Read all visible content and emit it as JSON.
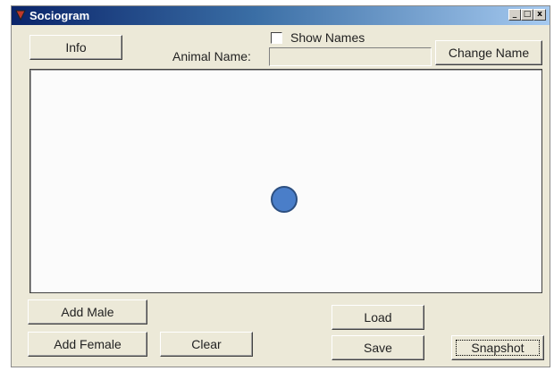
{
  "window": {
    "title": "Sociogram",
    "controls": {
      "minimize": "_",
      "maximize": "□",
      "close": "x"
    }
  },
  "toolbar": {
    "info_label": "Info",
    "show_names_label": "Show Names",
    "show_names_checked": false,
    "animal_name_label": "Animal Name:",
    "animal_name_value": "",
    "change_name_label": "Change Name"
  },
  "canvas": {
    "nodes": [
      {
        "type": "animal",
        "color": "#4a7ec9"
      }
    ]
  },
  "bottom": {
    "add_male_label": "Add Male",
    "add_female_label": "Add Female",
    "clear_label": "Clear",
    "load_label": "Load",
    "save_label": "Save",
    "snapshot_label": "Snapshot"
  }
}
